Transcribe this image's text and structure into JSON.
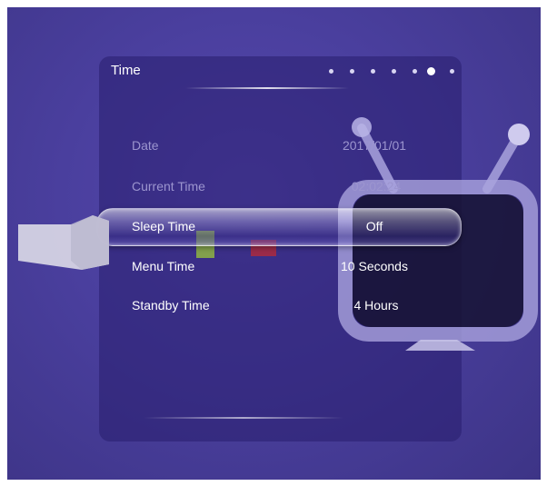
{
  "menu": {
    "title": "Time",
    "pages": {
      "count": 7,
      "active_index": 5
    },
    "items": [
      {
        "label": "Date",
        "value": "2017/01/01"
      },
      {
        "label": "Current Time",
        "value": "02:02:24"
      },
      {
        "label": "Sleep Time",
        "value": "Off"
      },
      {
        "label": "Menu Time",
        "value": "10 Seconds"
      },
      {
        "label": "Standby Time",
        "value": "4 Hours"
      }
    ],
    "selected_index": 2
  },
  "colors": {
    "background": "#4a3f9e",
    "panel": "#2b2170",
    "text": "#ffffff",
    "dim_text": "#9c95cf"
  },
  "icons": [
    "tv-icon",
    "pointer-hand-icon"
  ]
}
